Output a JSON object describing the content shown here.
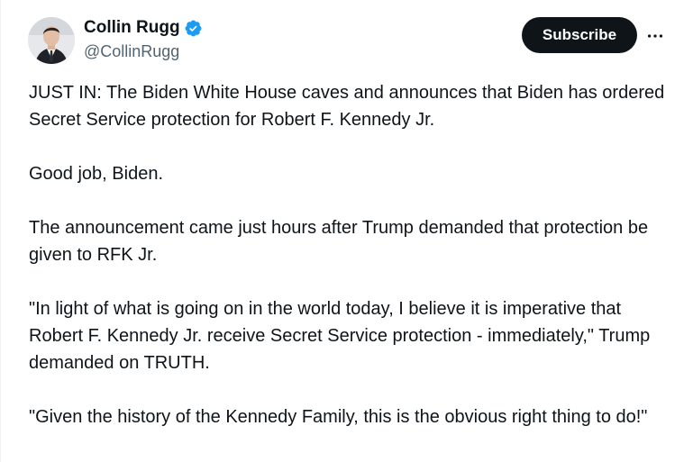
{
  "author": {
    "display_name": "Collin Rugg",
    "handle": "@CollinRugg"
  },
  "icons": {
    "verified": "verified-badge-icon",
    "more": "more-options-icon"
  },
  "colors": {
    "verified_blue": "#1d9bf0",
    "button_bg": "#0f1419",
    "secondary_text": "#536471"
  },
  "actions": {
    "subscribe_label": "Subscribe"
  },
  "tweet": {
    "paragraphs": [
      "JUST IN: The Biden White House caves and announces that Biden has ordered Secret Service protection for Robert F. Kennedy Jr.",
      "Good job, Biden.",
      "The announcement came just hours after Trump demanded that protection be given to RFK Jr.",
      "\"In light of what is going on in the world today, I believe it is imperative that Robert F. Kennedy Jr. receive Secret Service protection - immediately,\" Trump demanded on TRUTH.",
      "\"Given the history of the Kennedy Family, this is the obvious right thing to do!\""
    ]
  }
}
